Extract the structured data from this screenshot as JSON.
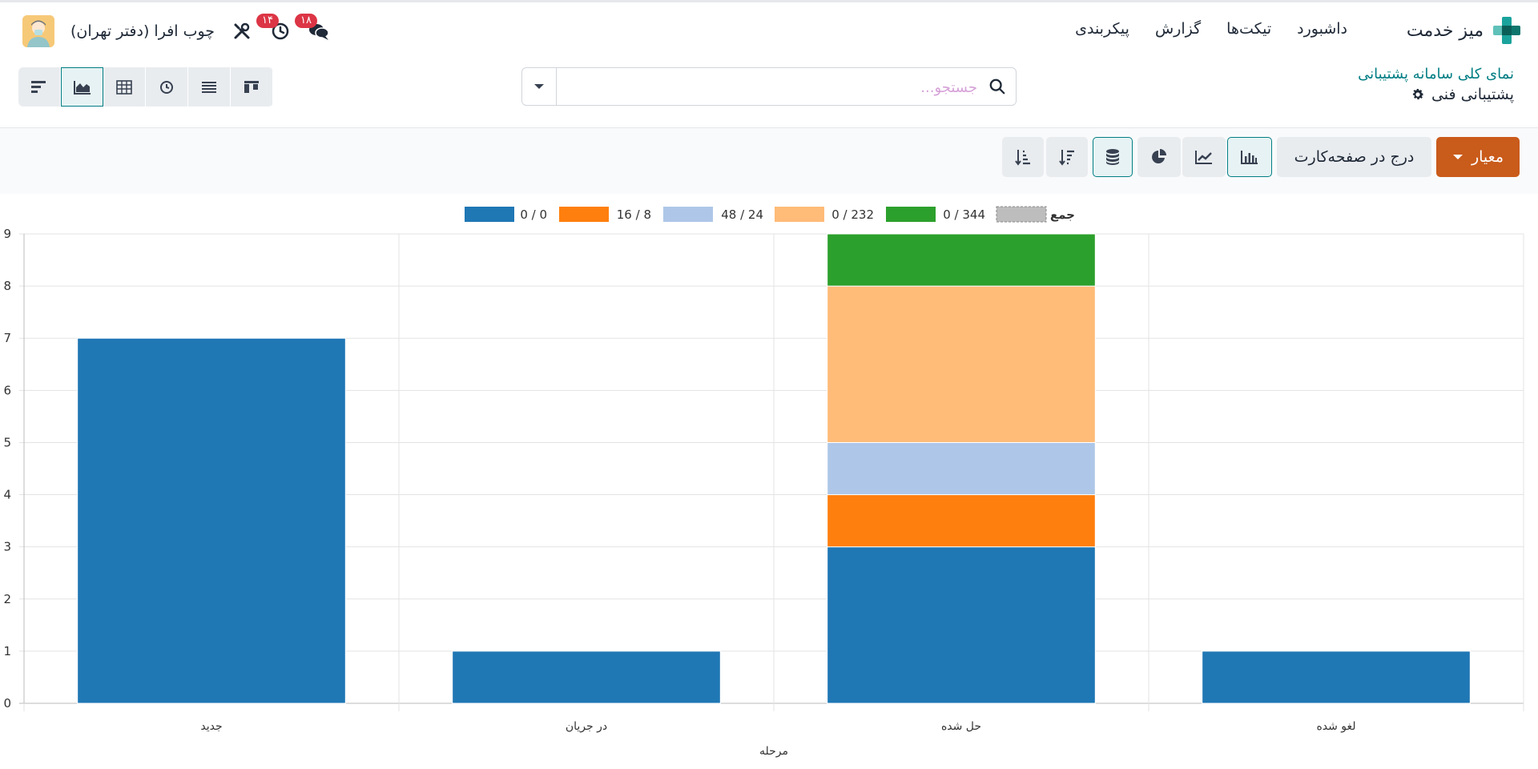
{
  "navbar": {
    "app_name": "میز خدمت",
    "menu": [
      "داشبورد",
      "تیکت‌ها",
      "گزارش",
      "پیکربندی"
    ],
    "company": "چوب افرا (دفتر تهران)",
    "messages_badge": "۱۸",
    "activities_badge": "۱۴"
  },
  "breadcrumb": {
    "parent": "نمای کلی سامانه پشتیبانی",
    "current": "پشتیبانی فنی"
  },
  "search": {
    "placeholder": "جستجو..."
  },
  "toolbar": {
    "measure_label": "معیار",
    "insert_label": "درج در صفحه‌کارت"
  },
  "view_switcher": [
    "kanban",
    "list",
    "activity",
    "pivot",
    "graph",
    "gantt"
  ],
  "colors": {
    "accent": "#017e84",
    "primary_button": "#c95b1b",
    "series": [
      "#1f77b4",
      "#ff7f0e",
      "#aec7e8",
      "#ffbb78",
      "#2ca02c"
    ]
  },
  "chart_data": {
    "type": "bar",
    "stacked": true,
    "categories": [
      "جدید",
      "در جریان",
      "حل شده",
      "لغو شده"
    ],
    "xlabel": "مرحله",
    "ylabel": "",
    "ylim": [
      0,
      9
    ],
    "grid": true,
    "legend_position": "top",
    "legend_total_label": "جمع",
    "series": [
      {
        "name": "0 / 0",
        "color": "#1f77b4",
        "values": [
          7,
          1,
          3,
          1
        ]
      },
      {
        "name": "16 / 8",
        "color": "#ff7f0e",
        "values": [
          0,
          0,
          1,
          0
        ]
      },
      {
        "name": "48 / 24",
        "color": "#aec7e8",
        "values": [
          0,
          0,
          1,
          0
        ]
      },
      {
        "name": "0 / 232",
        "color": "#ffbb78",
        "values": [
          0,
          0,
          3,
          0
        ]
      },
      {
        "name": "0 / 344",
        "color": "#2ca02c",
        "values": [
          0,
          0,
          1,
          0
        ]
      }
    ]
  }
}
